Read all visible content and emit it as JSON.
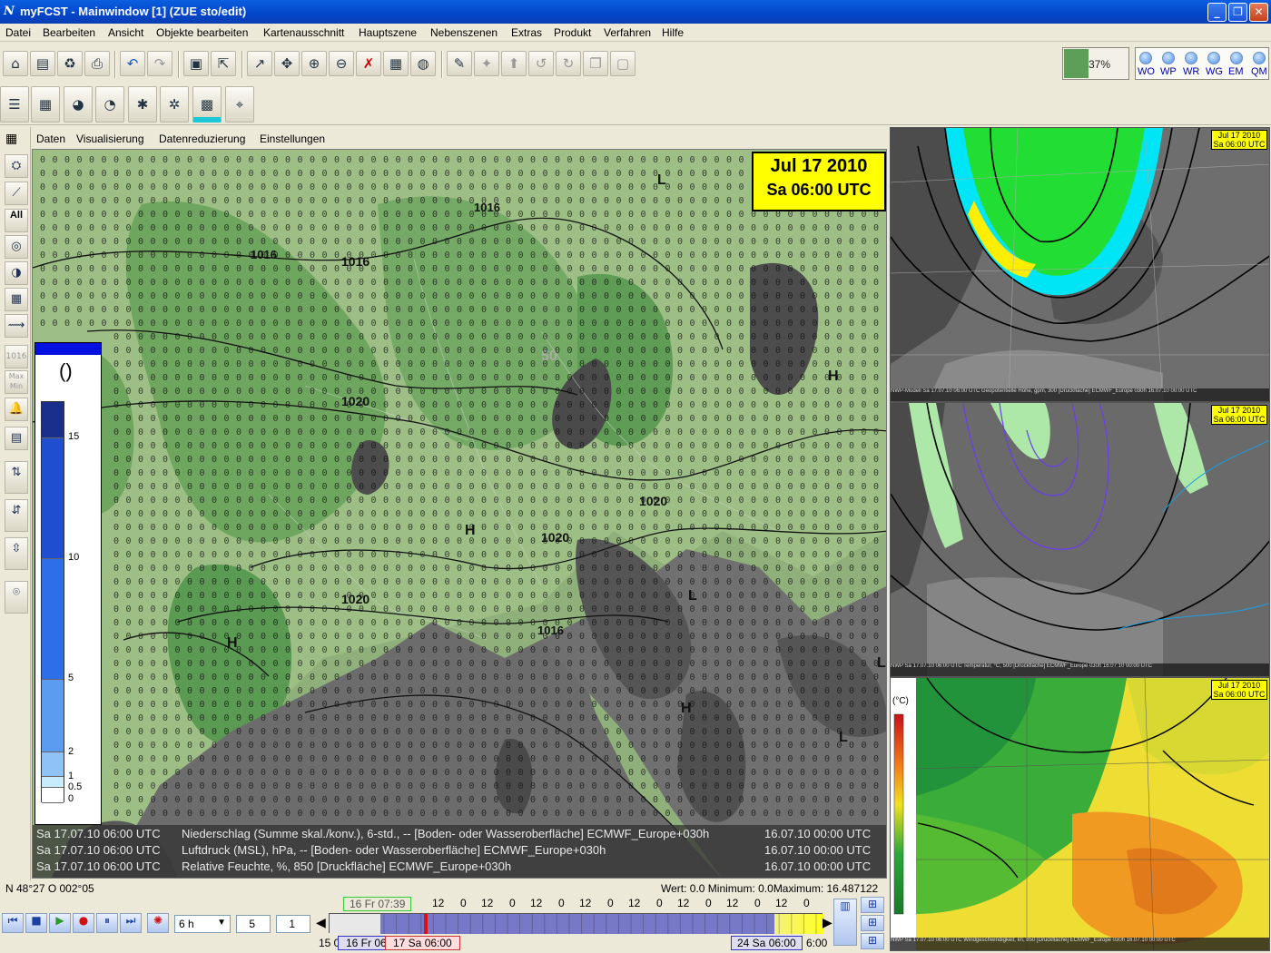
{
  "window": {
    "icon": "N",
    "title": "myFCST - Mainwindow [1] (ZUE sto/edit)",
    "minimize": "_",
    "maximize": "❐",
    "close": "✕"
  },
  "menu": [
    "Datei",
    "Bearbeiten",
    "Ansicht",
    "Objekte bearbeiten",
    "Kartenausschnitt",
    "Hauptszene",
    "Nebenszenen",
    "Extras",
    "Produkt",
    "Verfahren",
    "Hilfe"
  ],
  "toolbar": {
    "progress_value": 0.37,
    "progress_text": "37%",
    "indicators": [
      "WO",
      "WP",
      "WR",
      "WG",
      "EM",
      "QM"
    ]
  },
  "left_tools": {
    "all_label": "All",
    "ff_label": "1016",
    "maxmin_label": "Max Min"
  },
  "submenu": [
    "Daten",
    "Visualisierung",
    "Datenreduzierung",
    "Einstellungen"
  ],
  "main_map": {
    "date_line1": "Jul 17 2010",
    "date_line2": "Sa 06:00 UTC",
    "legend": {
      "unit": "()",
      "labels": [
        "15",
        "10",
        "5",
        "2",
        "1",
        "0.5",
        "0"
      ],
      "colors": [
        "#1a2f8c",
        "#1f4fd0",
        "#2e6ee8",
        "#5b9cf0",
        "#8fc3f5",
        "#c9ecfb",
        "#ffffff"
      ]
    },
    "isobar_labels": [
      "1016",
      "1016",
      "1020",
      "1020",
      "1020",
      "1020",
      "1016",
      "1016",
      "50"
    ],
    "pressure_centers": [
      "L",
      "H",
      "H",
      "H",
      "L",
      "H",
      "L",
      "L"
    ],
    "info_lines": [
      {
        "time": "Sa 17.07.10 06:00 UTC",
        "desc": "Niederschlag (Summe skal./konv.), 6-std., -- [Boden- oder Wasseroberfläche] ECMWF_Europe+030h",
        "run": "16.07.10 00:00 UTC"
      },
      {
        "time": "Sa 17.07.10 06:00 UTC",
        "desc": "Luftdruck (MSL), hPa, -- [Boden- oder Wasseroberfläche] ECMWF_Europe+030h",
        "run": "16.07.10 00:00 UTC"
      },
      {
        "time": "Sa 17.07.10 06:00 UTC",
        "desc": "Relative Feuchte, %, 850 [Druckfläche] ECMWF_Europe+030h",
        "run": "16.07.10 00:00 UTC"
      }
    ]
  },
  "right_panels": [
    {
      "date_line1": "Jul 17 2010",
      "date_line2": "Sa 06:00 UTC",
      "info": "NWP-Modell   Sa 17.07.10 06:00 UTC   Geopotentielle Höhe, gpm, 300 [Druckfläche] ECMWF_Europe 030h   16.07.10 00:00 UTC"
    },
    {
      "date_line1": "Jul 17 2010",
      "date_line2": "Sa 06:00 UTC",
      "info": "NWP  Sa 17.07.10 06:00 UTC   Temperatur, °C, 500 [Druckfläche] ECMWF_Europe 030h   16.07.10 00:00 UTC"
    },
    {
      "date_line1": "Jul 17 2010",
      "date_line2": "Sa 06:00 UTC",
      "unit": "(°C)",
      "info": "NWP  Sa 17.07.10 06:00 UTC   Windgeschwindigkeit, kn, 850 [Druckfläche] ECMWF_Europe 030h   16.07.10 00:00 UTC"
    }
  ],
  "status": {
    "coords": "N 48°27 O 002°05",
    "values": "Wert: 0.0 Minimum: 0.0Maximum: 16.487122"
  },
  "timeline": {
    "step": "6 h",
    "spin1": "5",
    "spin2": "1",
    "hours": [
      "12",
      "0",
      "12",
      "0",
      "12",
      "0",
      "12",
      "0",
      "12",
      "0",
      "12",
      "0",
      "12",
      "0",
      "12",
      "0"
    ],
    "now_label": "16 Fr 07:39",
    "start_label": "15 0",
    "left_label": "16 Fr 06",
    "current_label": "17 Sa 06:00",
    "end_label": "24 Sa 06:00",
    "end_suffix": "6:00"
  }
}
